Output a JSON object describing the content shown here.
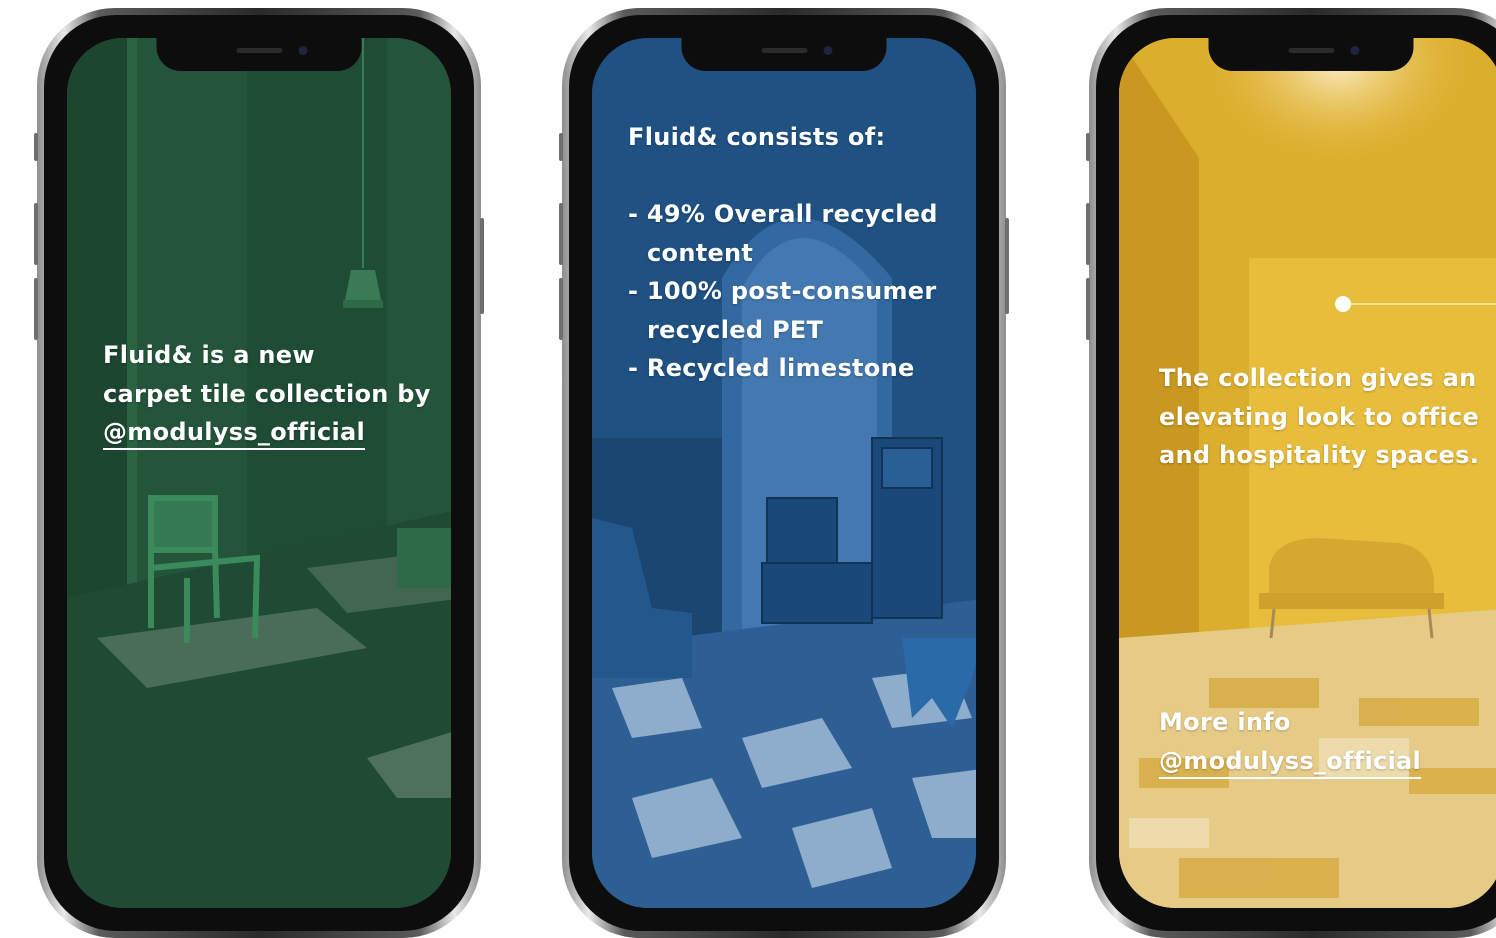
{
  "slides": [
    {
      "theme": "green",
      "colors": {
        "wall": "#24553a",
        "floor": "#1f4a33",
        "chair": "#3b8a5c"
      },
      "text_lines": [
        "Fluid& is a new",
        "carpet tile collection by"
      ],
      "handle": "@modulyss_official"
    },
    {
      "theme": "blue",
      "colors": {
        "wall": "#235a90",
        "floor": "#3a6ea8",
        "accent": "#bcd3ea"
      },
      "heading": "Fluid& consists of:",
      "bullets": [
        "- 49% Overall recycled",
        "content",
        "- 100% post-consumer",
        "recycled PET",
        "- Recycled limestone"
      ]
    },
    {
      "theme": "yellow",
      "colors": {
        "wall": "#e2b532",
        "floor": "#e7cf8a",
        "accent": "#fff3c4"
      },
      "text_lines": [
        "The collection gives an",
        "elevating look to office",
        "and hospitality spaces."
      ],
      "more_info": "More info",
      "handle": "@modulyss_official"
    }
  ]
}
